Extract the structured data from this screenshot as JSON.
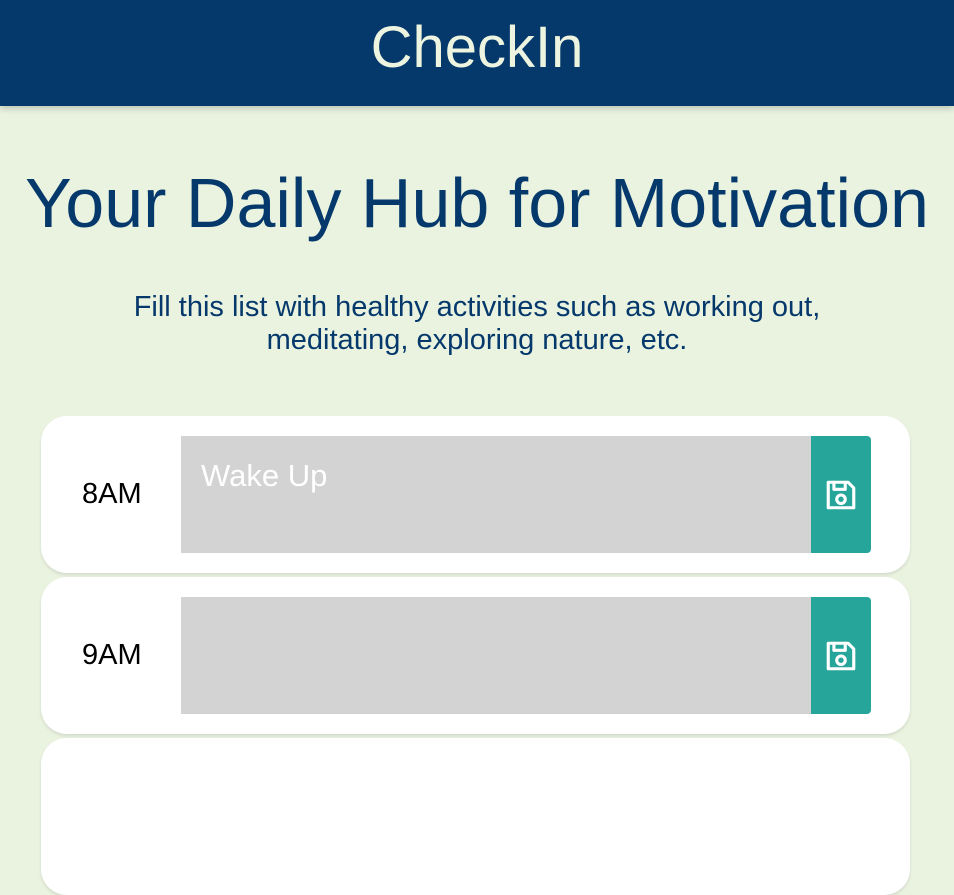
{
  "header": {
    "brand": "CheckIn"
  },
  "hero": {
    "title": "Your Daily Hub for Motivation",
    "subtitle": "Fill this list with healthy activities such as working out, meditating, exploring nature, etc."
  },
  "schedule": [
    {
      "hour": "8AM",
      "activity": "Wake Up",
      "save_icon": "save-icon"
    },
    {
      "hour": "9AM",
      "activity": "",
      "save_icon": "save-icon"
    }
  ],
  "colors": {
    "header_bg": "#05386b",
    "brand_text": "#edf5e1",
    "page_bg": "#eaf3e0",
    "heading_text": "#05386b",
    "textarea_bg": "#d3d3d3",
    "save_button": "#26a69a"
  }
}
